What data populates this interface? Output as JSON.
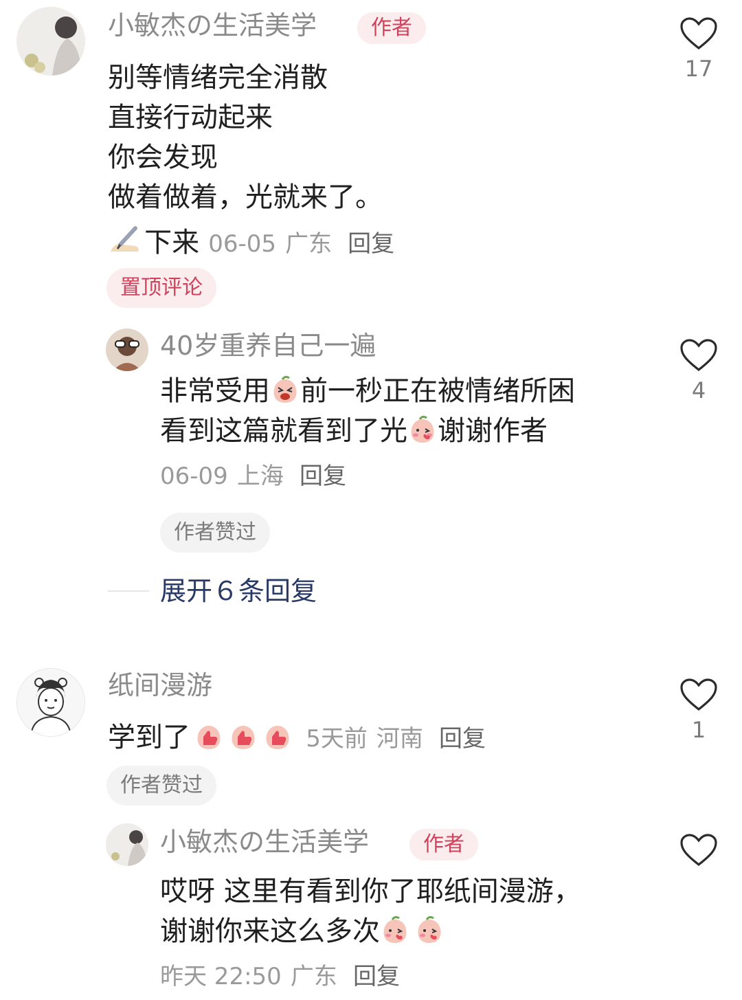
{
  "colors": {
    "accent": "#d0415b",
    "badge_bg": "#fbecee",
    "name": "#8a8a8a",
    "link": "#2a3a66"
  },
  "comments": [
    {
      "author": "小敏杰の生活美学",
      "badge": "作者",
      "lines": [
        "别等情绪完全消散",
        "直接行动起来",
        "你会发现",
        "做着做着，光就来了。"
      ],
      "sign_icon": "writing-hand-icon",
      "sign": "下来",
      "date": "06-05",
      "location": "广东",
      "reply_label": "回复",
      "tag": "置顶评论",
      "likes": "17",
      "replies": [
        {
          "author": "40岁重养自己一遍",
          "line1_a": "非常受用",
          "line1_b": "前一秒正在被情绪所困",
          "line2_a": "看到这篇就看到了光",
          "line2_b": "谢谢作者",
          "emoji": [
            "laughing-peach-icon",
            "blushing-peach-icon"
          ],
          "date": "06-09",
          "location": "上海",
          "reply_label": "回复",
          "tag": "作者赞过",
          "likes": "4"
        }
      ],
      "expand_label": "展开６条回复"
    },
    {
      "author": "纸间漫游",
      "text": "学到了",
      "emoji": [
        "thumbs-up-peach-icon",
        "thumbs-up-peach-icon",
        "thumbs-up-peach-icon"
      ],
      "date": "5天前",
      "location": "河南",
      "reply_label": "回复",
      "tag": "作者赞过",
      "likes": "1",
      "replies": [
        {
          "author": "小敏杰の生活美学",
          "badge": "作者",
          "line1": "哎呀 这里有看到你了耶纸间漫游，",
          "line2": "谢谢你来这么多次",
          "emoji": [
            "blushing-peach-icon",
            "blushing-peach-icon"
          ],
          "date": "昨天 22:50",
          "location": "广东",
          "reply_label": "回复"
        }
      ]
    }
  ]
}
